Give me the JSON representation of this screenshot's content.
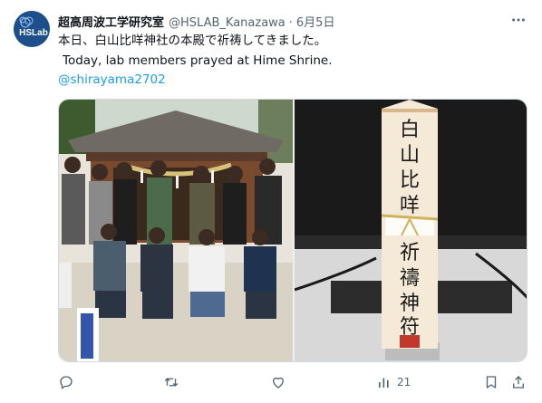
{
  "author": {
    "display_name": "超高周波工学研究室",
    "handle": "@HSLAB_Kanazawa",
    "separator": "·",
    "date": "6月5日",
    "avatar_text": "HSLab"
  },
  "tweet": {
    "line1": "本日、白山比咩神社の本殿で祈祷してきました。",
    "line2": "Today, lab members prayed at Hime Shrine.",
    "mention": "@shirayama2702"
  },
  "media": {
    "left_image": "group photo in front of shrine",
    "right_image": "wooden prayer charm on desk",
    "charm_text": [
      "白",
      "山",
      "比",
      "咩",
      "祈",
      "禱",
      "神",
      "符"
    ]
  },
  "actions": {
    "reply_icon": "reply-icon",
    "retweet_icon": "retweet-icon",
    "like_icon": "like-icon",
    "views_icon": "views-icon",
    "views_count": "21",
    "bookmark_icon": "bookmark-icon",
    "share_icon": "share-icon"
  },
  "colors": {
    "text": "#0f1419",
    "secondary": "#536471",
    "link": "#1d9bf0",
    "border": "#cfd9de"
  }
}
